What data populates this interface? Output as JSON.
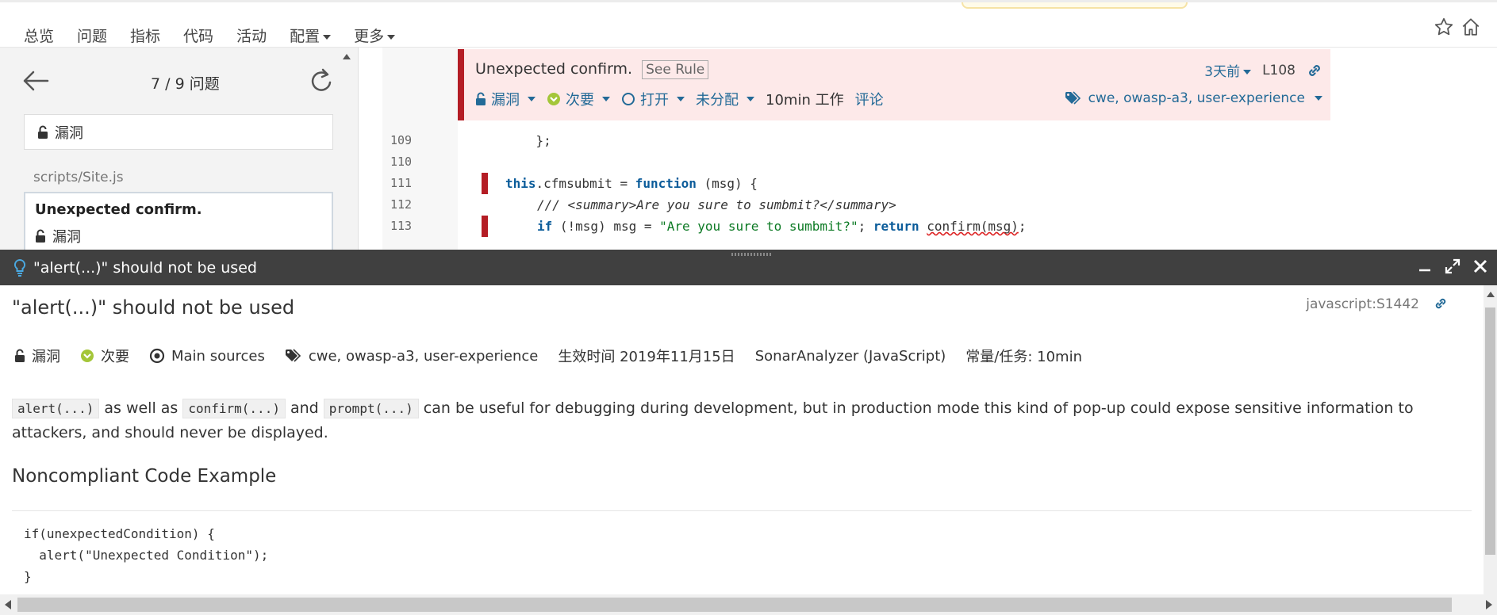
{
  "nav": {
    "tabs": [
      {
        "label": "总览"
      },
      {
        "label": "问题",
        "active": true
      },
      {
        "label": "指标"
      },
      {
        "label": "代码"
      },
      {
        "label": "活动"
      },
      {
        "label": "配置"
      },
      {
        "label": "更多"
      }
    ],
    "icons": [
      "star-icon",
      "home-icon"
    ]
  },
  "issues_nav": {
    "counter": "7 / 9 问题",
    "filter_label": "漏洞",
    "file": "scripts/Site.js",
    "card": {
      "title": "Unexpected confirm.",
      "type": "漏洞"
    }
  },
  "issue": {
    "message": "Unexpected confirm.",
    "see_rule": "See Rule",
    "age": "3天前",
    "line": "L108",
    "type": "漏洞",
    "severity": "次要",
    "status": "打开",
    "assignee": "未分配",
    "effort": "10min 工作",
    "comment": "评论",
    "tags": "cwe, owasp-a3, user-experience"
  },
  "code": {
    "lines": [
      {
        "n": "109"
      },
      {
        "n": "110"
      },
      {
        "n": "111"
      },
      {
        "n": "112"
      },
      {
        "n": "113"
      }
    ],
    "l109": "    };",
    "l111_this": "this",
    "l111_a": ".cfmsubmit = ",
    "l111_fn": "function",
    "l111_b": " (msg) {",
    "l112": "/// <summary>Are you sure to sumbmit?</summary>",
    "l113_if": "if",
    "l113_a": " (!msg) msg = ",
    "l113_str": "\"Are you sure to sumbmit?\"",
    "l113_b": "; ",
    "l113_ret": "return",
    "l113_c": " ",
    "l113_call": "confirm(msg)",
    "l113_d": ";"
  },
  "rule": {
    "bar_title": "\"alert(...)\" should not be used",
    "title": "\"alert(...)\" should not be used",
    "key": "javascript:S1442",
    "type": "漏洞",
    "severity": "次要",
    "scope": "Main sources",
    "tags": "cwe, owasp-a3, user-experience",
    "effective": "生效时间 2019年11月15日",
    "analyzer": "SonarAnalyzer (JavaScript)",
    "effort": "常量/任务: 10min",
    "desc_code1": "alert(...)",
    "desc_t1": " as well as ",
    "desc_code2": "confirm(...)",
    "desc_t2": " and ",
    "desc_code3": "prompt(...)",
    "desc_t3": " can be useful for debugging during development, but in production mode this kind of pop-up could expose sensitive information to attackers, and should never be displayed.",
    "subheading": "Noncompliant Code Example",
    "example": "if(unexpectedCondition) {\n  alert(\"Unexpected Condition\");\n}"
  },
  "colors": {
    "accent": "#3d9bd3",
    "issue_marker": "#b41d25",
    "issue_bg": "#fde9e9",
    "link": "#236a97",
    "rule_bar": "#404040",
    "severity_minor": "#a4c639"
  }
}
